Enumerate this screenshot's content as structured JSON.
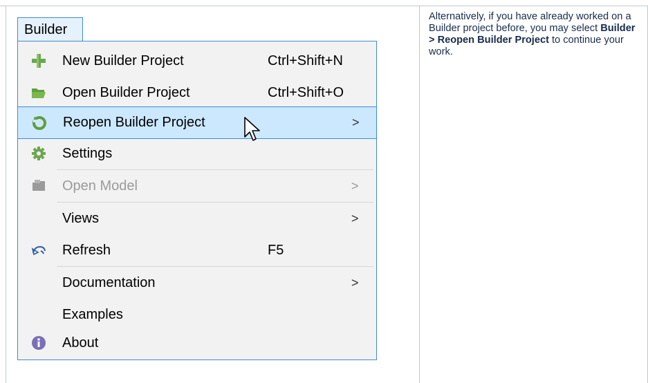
{
  "menubar": {
    "title": "Builder"
  },
  "menu": {
    "items": [
      {
        "label": "New Builder Project",
        "shortcut": "Ctrl+Shift+N",
        "icon": "plus-icon"
      },
      {
        "label": "Open Builder Project",
        "shortcut": "Ctrl+Shift+O",
        "icon": "folder-open-icon"
      },
      {
        "label": "Reopen Builder Project",
        "arrow": ">",
        "icon": "reopen-icon"
      },
      {
        "label": "Settings",
        "icon": "gear-icon"
      },
      {
        "label": "Open Model",
        "arrow": ">",
        "icon": "model-icon"
      },
      {
        "label": "Views",
        "arrow": ">"
      },
      {
        "label": "Refresh",
        "shortcut": "F5",
        "icon": "refresh-icon"
      },
      {
        "label": "Documentation",
        "arrow": ">"
      },
      {
        "label": "Examples"
      },
      {
        "label": "About",
        "icon": "info-icon"
      }
    ]
  },
  "description": {
    "text_before": "Alternatively, if you have already worked on a Builder project before, you may select ",
    "bold": "Builder > Reopen Builder Project",
    "text_after": " to continue your work."
  },
  "colors": {
    "highlight_bg": "#cce8ff",
    "highlight_border": "#3d8bd1",
    "menu_bg": "#f2f2f2",
    "disabled_text": "#9a9a9a"
  }
}
